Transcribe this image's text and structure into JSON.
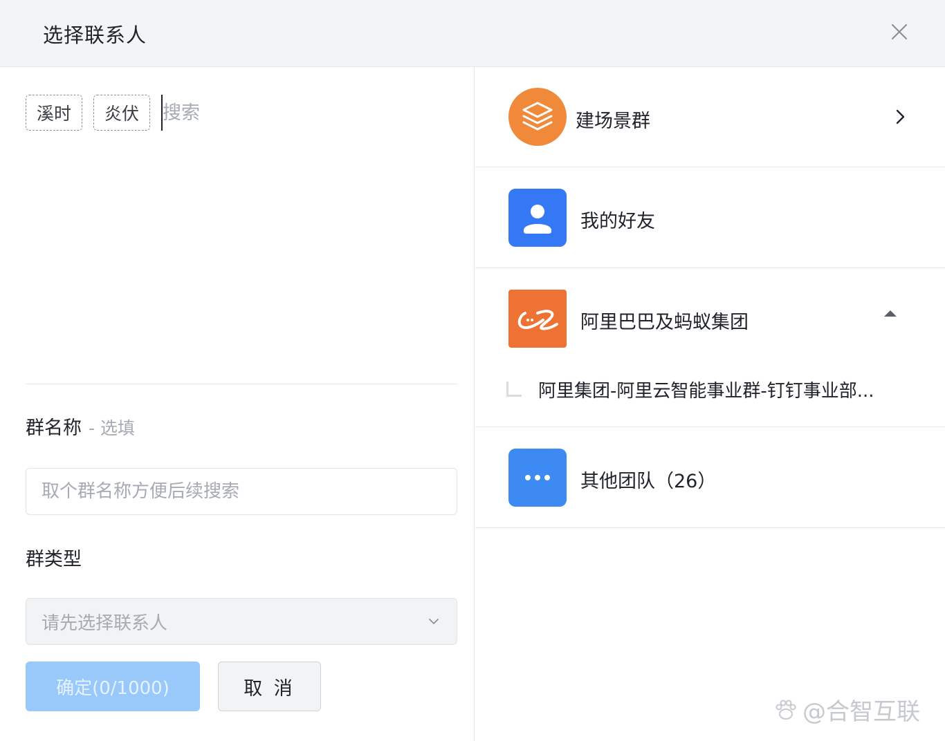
{
  "dialog": {
    "title": "选择联系人",
    "close_icon": "close-icon"
  },
  "left": {
    "chips": [
      "溪时",
      "炎伏"
    ],
    "search_placeholder": "搜索",
    "group_name": {
      "label": "群名称",
      "optional": "- 选填",
      "placeholder": "取个群名称方便后续搜索"
    },
    "group_type": {
      "label": "群类型",
      "value": "请先选择联系人"
    },
    "ok_button": "确定(0/1000)",
    "cancel_button": "取 消"
  },
  "right": {
    "items": [
      {
        "label": "建场景群",
        "icon": "layers-icon",
        "color": "#f0893a",
        "trailing": "chevron-right-icon"
      },
      {
        "label": "我的好友",
        "icon": "user-icon",
        "color": "#3478f6"
      },
      {
        "label": "阿里巴巴及蚂蚁集团",
        "icon": "alibaba-logo",
        "color": "#ee7233",
        "trailing": "caret-up-icon",
        "children": [
          "阿里集团-阿里云智能事业群-钉钉事业部..."
        ]
      },
      {
        "label": "其他团队（26）",
        "icon": "more-icon",
        "color": "#3d8bf2"
      }
    ]
  },
  "watermark": {
    "text": "@合智互联"
  }
}
